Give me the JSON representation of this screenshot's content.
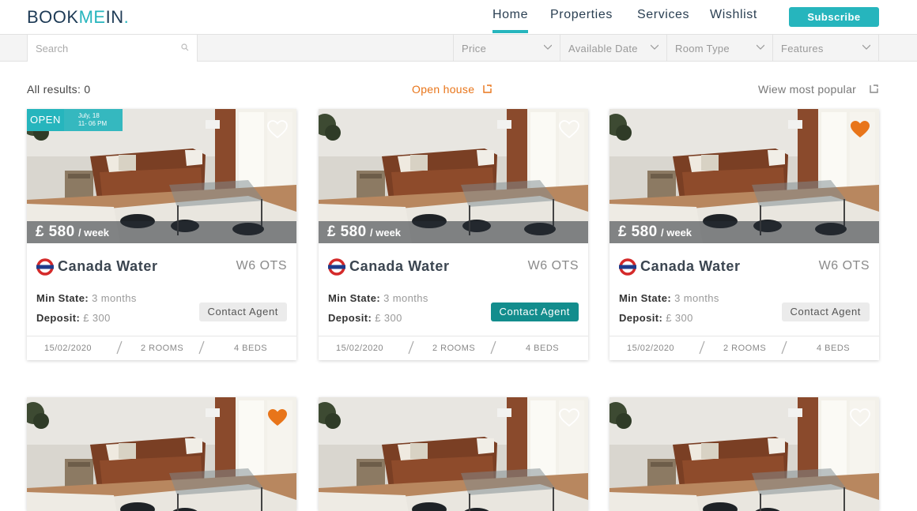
{
  "header": {
    "logo": {
      "part1": "BOOK",
      "part2": "ME",
      "part3": "IN",
      "dot": "."
    },
    "nav": [
      "Home",
      "Properties",
      "Services",
      "Wishlist"
    ],
    "active_nav": "Home",
    "subscribe_label": "Subscribe"
  },
  "filters": {
    "search_placeholder": "Search",
    "dropdowns": [
      "Price",
      "Available Date",
      "Room Type",
      "Features"
    ]
  },
  "results": {
    "label": "All results: 0",
    "open_house_link": "Open house",
    "popular_link": "Wiew most popular"
  },
  "colors": {
    "accent": "#26b5bd",
    "contact_active": "#138d8d",
    "orange": "#e8751a",
    "navy": "#1e3b56"
  },
  "cards": [
    {
      "price": "£ 580",
      "per": "/ week",
      "location": "Canada Water",
      "postcode": "W6 OTS",
      "min_state_label": "Min State:",
      "min_state": "3 months",
      "deposit_label": "Deposit:",
      "deposit": "£ 300",
      "contact_label": "Contact Agent",
      "date": "15/02/2020",
      "rooms": "2 ROOMS",
      "beds": "4 BEDS",
      "favorited": false,
      "open_badge": {
        "label": "OPEN",
        "date": "July, 18",
        "time": "11- 06 PM"
      }
    },
    {
      "price": "£ 580",
      "per": "/ week",
      "location": "Canada Water",
      "postcode": "W6 OTS",
      "min_state_label": "Min State:",
      "min_state": "3 months",
      "deposit_label": "Deposit:",
      "deposit": "£ 300",
      "contact_label": "Contact Agent",
      "date": "15/02/2020",
      "rooms": "2 ROOMS",
      "beds": "4 BEDS",
      "favorited": false,
      "contact_active": true
    },
    {
      "price": "£ 580",
      "per": "/ week",
      "location": "Canada Water",
      "postcode": "W6 OTS",
      "min_state_label": "Min State:",
      "min_state": "3 months",
      "deposit_label": "Deposit:",
      "deposit": "£ 300",
      "contact_label": "Contact Agent",
      "date": "15/02/2020",
      "rooms": "2 ROOMS",
      "beds": "4 BEDS",
      "favorited": true
    },
    {
      "favorited": true
    },
    {
      "favorited": false
    },
    {
      "favorited": false
    }
  ],
  "icons": {
    "search": "search-icon",
    "dropdown": "chevron-down-icon",
    "external": "external-link-icon",
    "favorite": "heart-icon",
    "station": "underground-icon"
  }
}
